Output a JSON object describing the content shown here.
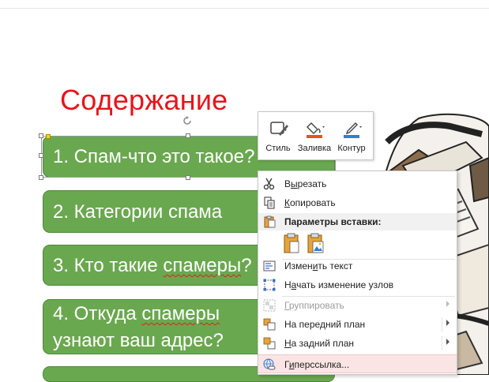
{
  "slide": {
    "title": "Содержание",
    "items": [
      {
        "label": "1. Спам-что это такое?"
      },
      {
        "label": "2. Категории спама"
      },
      {
        "label_pre": "3. Кто такие ",
        "label_mark": "спамеры",
        "label_post": "?"
      },
      {
        "line1_pre": "4. Откуда ",
        "line1_mark": "спамеры",
        "line2": "узнают ваш адрес?"
      }
    ]
  },
  "mini_toolbar": {
    "style_label": "Стиль",
    "fill_label": "Заливка",
    "outline_label": "Контур"
  },
  "context_menu": {
    "cut": {
      "pre": "В",
      "key": "ы",
      "post": "резать"
    },
    "copy": {
      "key": "К",
      "post": "опировать"
    },
    "paste_header": "Параметры вставки:",
    "edit_text": {
      "pre": "Измен",
      "key": "и",
      "post": "ть текст"
    },
    "edit_points": {
      "pre": "Н",
      "key": "а",
      "post": "чать изменение узлов"
    },
    "group": {
      "key": "Г",
      "post": "руппировать"
    },
    "bring_front": {
      "pre": "На пере",
      "key": "д",
      "post": "ний план"
    },
    "send_back": {
      "pre": "",
      "key": "Н",
      "post": "а задний план"
    },
    "hyperlink": {
      "pre": "Г",
      "key": "и",
      "post": "перссылка..."
    }
  },
  "colors": {
    "title": "#e8141b",
    "box_fill": "#6aa84f",
    "highlight": "#fbe4e4",
    "fill_accent": "#e2571c",
    "outline_accent": "#2f7fd3"
  }
}
